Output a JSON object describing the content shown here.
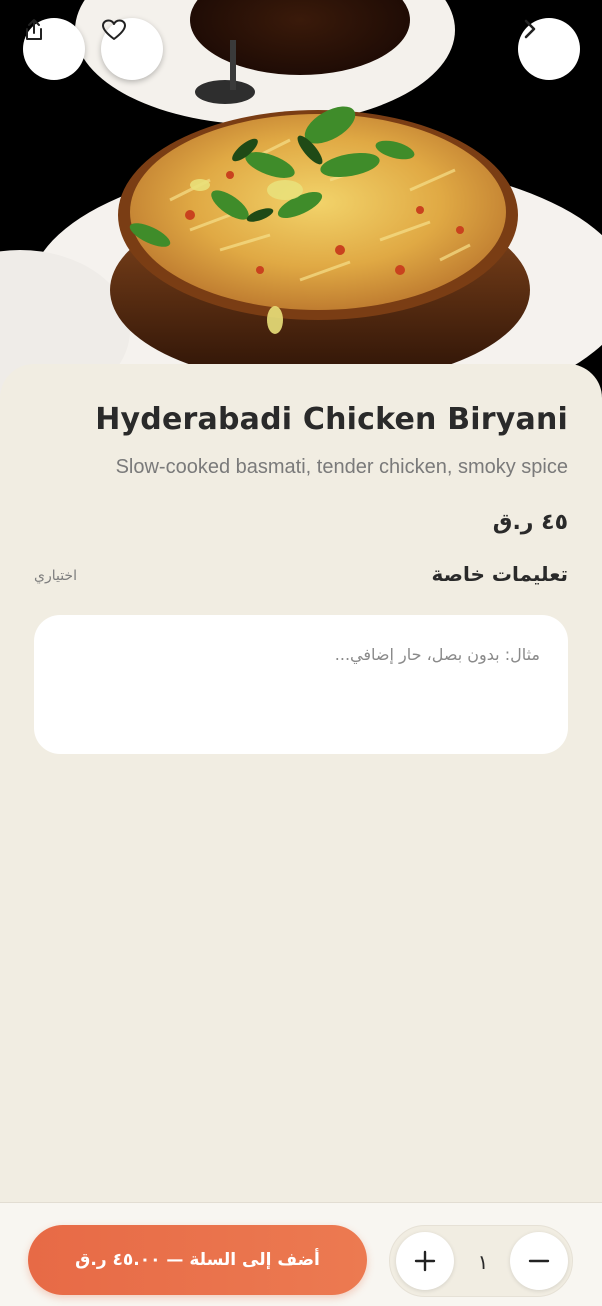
{
  "hero": {
    "icons": [
      "share-icon",
      "heart-icon",
      "chevron-right-icon"
    ]
  },
  "dish": {
    "name": "Hyderabadi Chicken Biryani",
    "description": "Slow-cooked basmati, tender chicken, smoky spice",
    "price": "٤٥ ر.ق"
  },
  "instructions": {
    "label": "تعليمات خاصة",
    "optional": "اختياري",
    "placeholder": "مثال: بدون بصل، حار إضافي...",
    "value": ""
  },
  "cart": {
    "add_label": "أضف إلى السلة — ٤٥.٠٠ ر.ق",
    "quantity": "١"
  },
  "colors": {
    "accent": "#e76a46",
    "background": "#f1ede2"
  }
}
